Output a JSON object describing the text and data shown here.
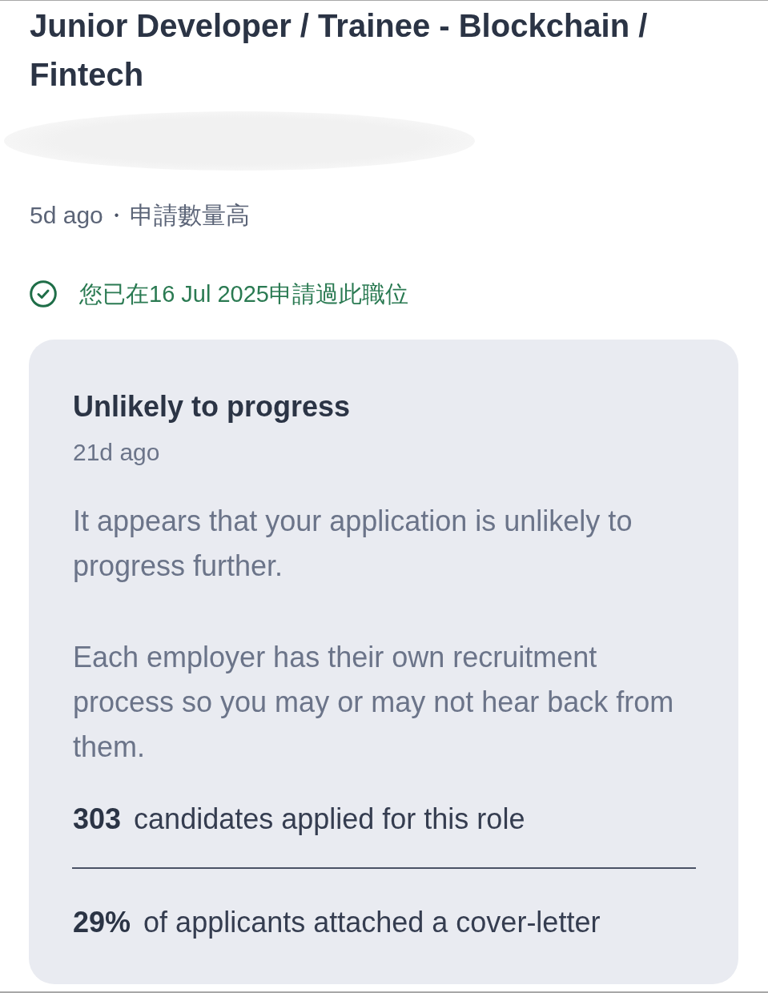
{
  "posting": {
    "title": "Junior Developer / Trainee - Blockchain / Fintech",
    "company_redacted": true,
    "posted": "5d ago",
    "separator": "•",
    "demand": "申請數量高"
  },
  "application_notice": {
    "text": "您已在16 Jul 2025申請過此職位"
  },
  "status_card": {
    "title": "Unlikely to progress",
    "time": "21d ago",
    "paragraphs": [
      "It appears that your application is unlikely to progress further.",
      "Each employer has their own recruitment process so you may or may not hear back from them."
    ],
    "stats": [
      {
        "value": "303",
        "label": "candidates applied for this role"
      },
      {
        "value": "29%",
        "label": "of applicants attached a cover-letter"
      }
    ]
  }
}
